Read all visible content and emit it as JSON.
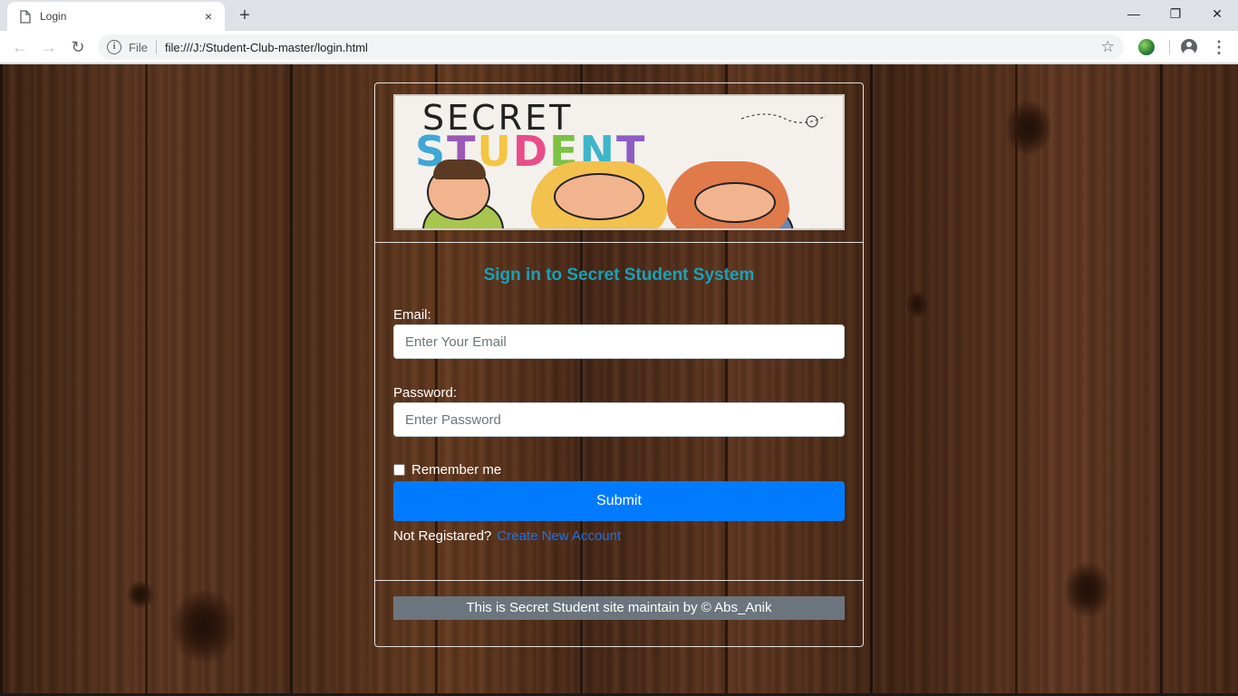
{
  "browser": {
    "tab_title": "Login",
    "tab_close": "×",
    "new_tab": "+",
    "window_controls": {
      "minimize": "—",
      "restore": "❐",
      "close": "✕"
    },
    "nav": {
      "back": "←",
      "forward": "→",
      "reload": "↻"
    },
    "omnibox": {
      "info_icon": "i",
      "scheme_label": "File",
      "url": "file:///J:/Student-Club-master/login.html",
      "star": "☆"
    },
    "menu": "⋮"
  },
  "logo": {
    "line1": "SECRET",
    "line2_letters": [
      "S",
      "T",
      "U",
      "D",
      "E",
      "N",
      "T"
    ],
    "line2_colors": [
      "#3fa7d6",
      "#9b59b6",
      "#f4c542",
      "#e84d8a",
      "#7cc243",
      "#3fb5c9",
      "#8e5bc4"
    ]
  },
  "form": {
    "title": "Sign in to Secret Student System",
    "email_label": "Email:",
    "email_placeholder": "Enter Your Email",
    "password_label": "Password:",
    "password_placeholder": "Enter Password",
    "remember_label": "Remember me",
    "remember_checked": false,
    "submit_label": "Submit",
    "not_registered_text": "Not Registared?",
    "create_account_link": "Create New Account"
  },
  "footer": {
    "text": "This is Secret Student site maintain by © Abs_Anik"
  },
  "colors": {
    "accent_title": "#17a2b8",
    "primary_button": "#007bff",
    "link": "#1a73e8",
    "footer_bar": "#6c757d"
  }
}
